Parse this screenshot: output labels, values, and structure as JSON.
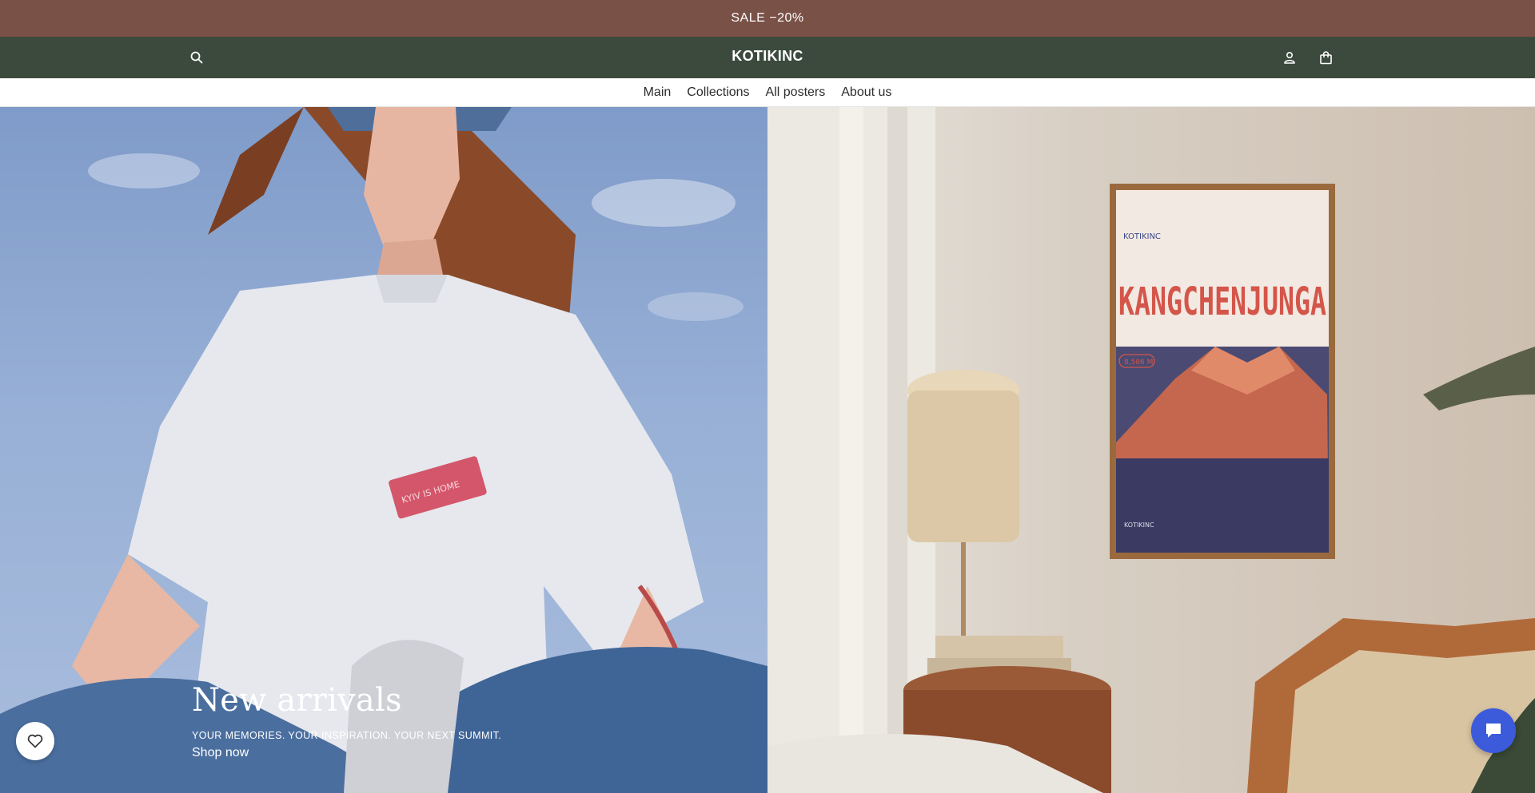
{
  "announcement": {
    "text": "SALE −20%"
  },
  "header": {
    "logo": "KOTIKINC",
    "icons": {
      "search": "search-icon",
      "account": "user-icon",
      "cart": "shopping-bag-icon"
    }
  },
  "nav": {
    "items": [
      {
        "label": "Main"
      },
      {
        "label": "Collections"
      },
      {
        "label": "All posters"
      },
      {
        "label": "About us"
      }
    ]
  },
  "hero": {
    "headline": "New arrivals",
    "subheadline": "YOUR MEMORIES. YOUR INSPIRATION. YOUR NEXT SUMMIT.",
    "cta": "Shop now",
    "left_image": {
      "tshirt_badge": "KYIV IS HOME"
    },
    "right_image": {
      "poster_title": "KANGCHENJUNGA",
      "poster_elevation": "8,586 M",
      "poster_brand": "KOTIKINC"
    }
  },
  "floating": {
    "wishlist": "heart-icon",
    "chat": "chat-icon"
  },
  "colors": {
    "announcement_bg": "#7a5147",
    "header_bg": "#3b4a3d",
    "chat_button": "#3b5bdb",
    "poster_red": "#d4564a"
  }
}
